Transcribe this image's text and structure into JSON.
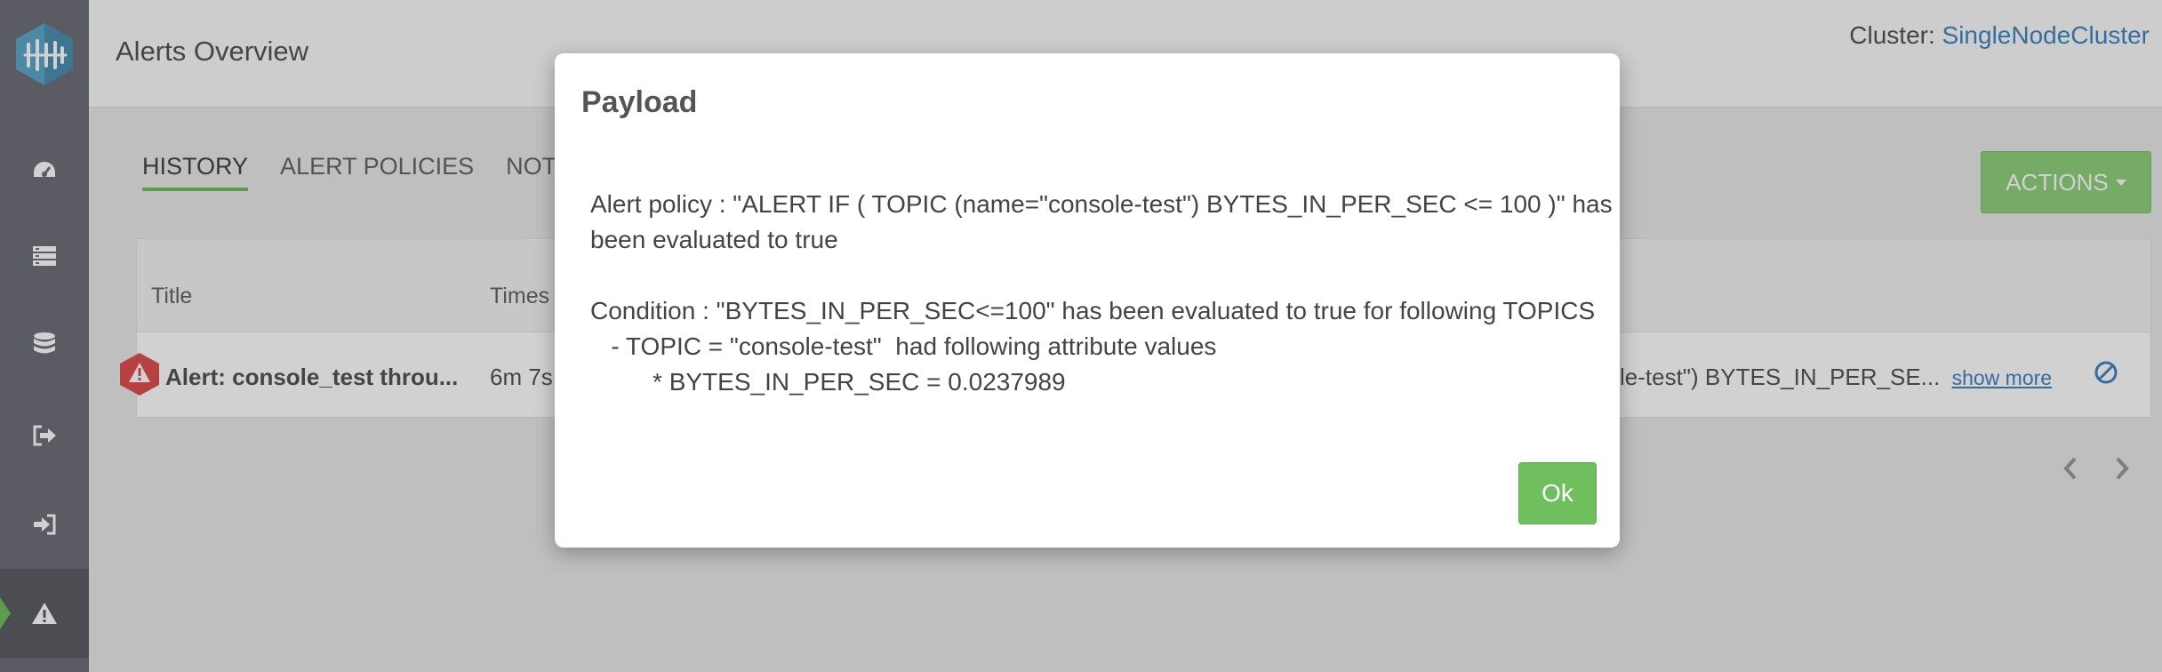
{
  "header": {
    "title": "Alerts Overview",
    "cluster_label": "Cluster:",
    "cluster_name": "SingleNodeCluster"
  },
  "sidebar": {
    "items": [
      {
        "icon": "dashboard-icon"
      },
      {
        "icon": "server-icon"
      },
      {
        "icon": "database-icon"
      },
      {
        "icon": "sign-out-icon"
      },
      {
        "icon": "sign-in-icon"
      },
      {
        "icon": "warning-icon",
        "active": true
      }
    ]
  },
  "tabs": [
    {
      "label": "HISTORY",
      "active": true
    },
    {
      "label": "ALERT POLICIES"
    },
    {
      "label": "NOTI"
    }
  ],
  "actions": {
    "label": "ACTIONS"
  },
  "table": {
    "columns": [
      "Title",
      "Times"
    ],
    "rows": [
      {
        "title": "Alert: console_test throu...",
        "time": "6m 7s",
        "payload_excerpt": "le-test\") BYTES_IN_PER_SE...",
        "show_more": "show more"
      }
    ]
  },
  "modal": {
    "title": "Payload",
    "lines": [
      "Alert policy : \"ALERT IF ( TOPIC (name=\"console-test\") BYTES_IN_PER_SEC <= 100 )\" has",
      "been evaluated to true",
      "",
      "Condition : \"BYTES_IN_PER_SEC<=100\" has been evaluated to true for following TOPICS",
      "   - TOPIC = \"console-test\"  had following attribute values",
      "         * BYTES_IN_PER_SEC = 0.0237989"
    ],
    "ok_label": "Ok"
  },
  "colors": {
    "accent_green": "#6fbf5e",
    "link_blue": "#3f87c4",
    "alert_red": "#e05050"
  }
}
